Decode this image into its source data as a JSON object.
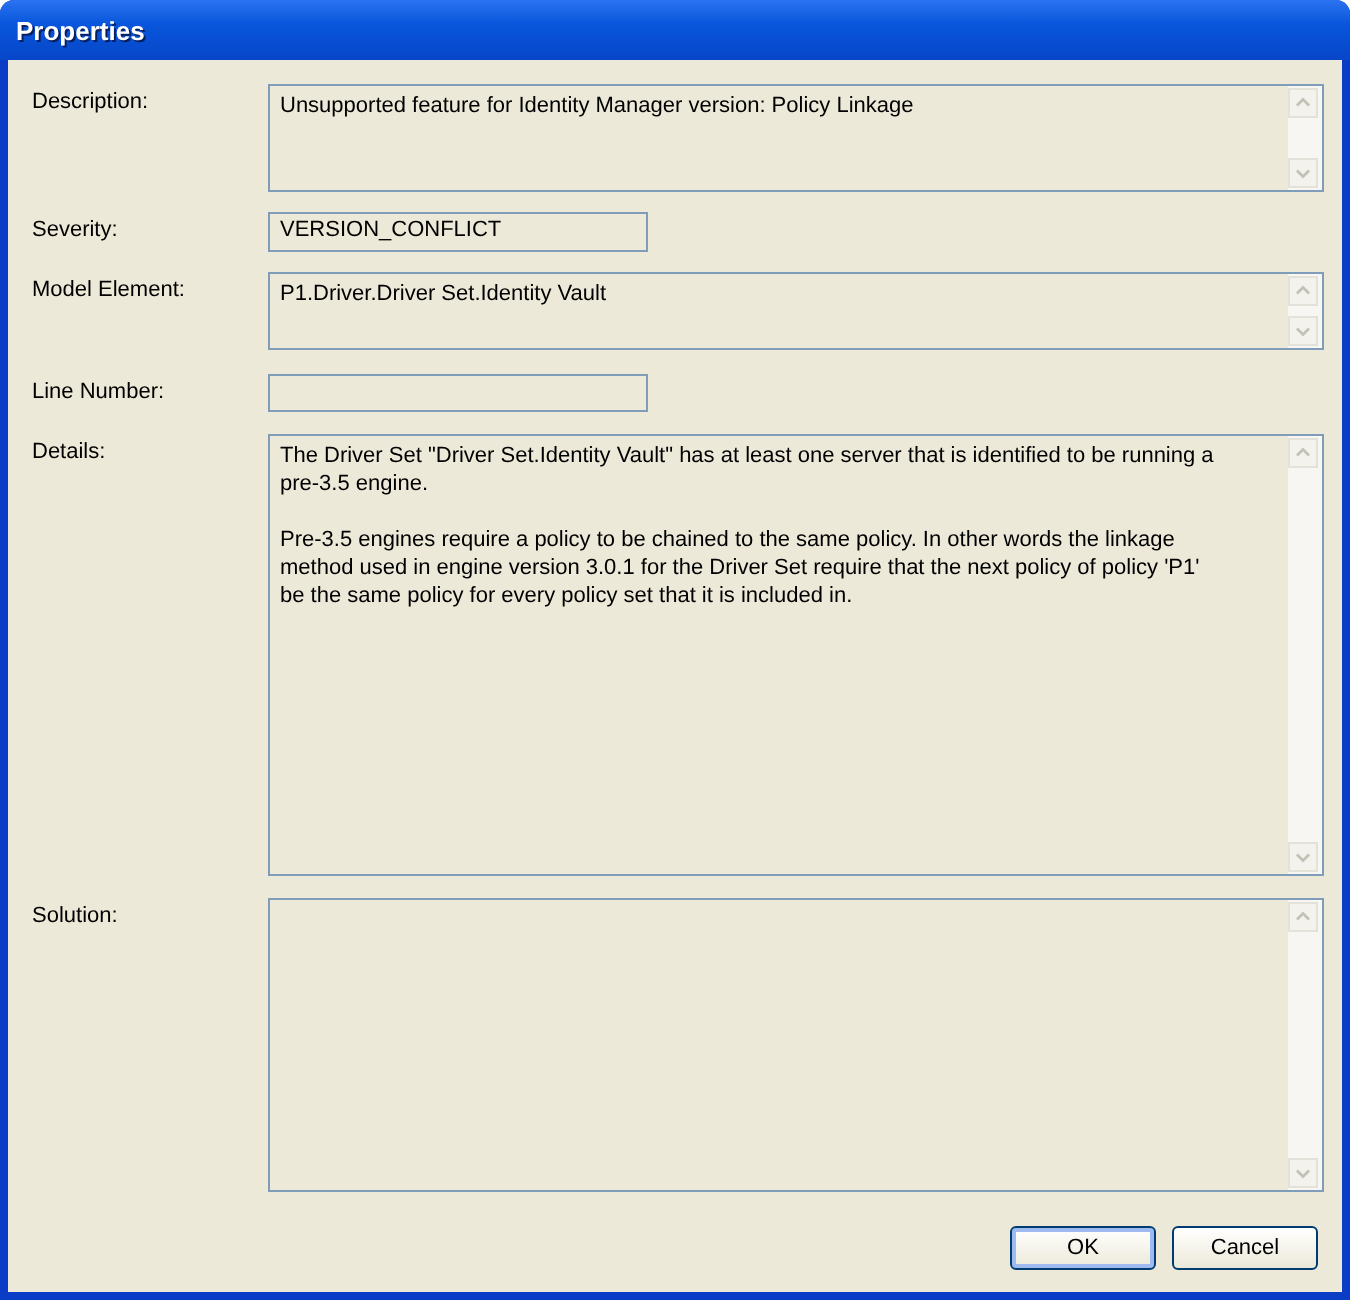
{
  "window": {
    "title": "Properties"
  },
  "fields": [
    {
      "label": "Description:",
      "kind": "textarea",
      "paragraphs": [
        "Unsupported feature for Identity Manager version: Policy Linkage"
      ]
    },
    {
      "label": "Severity:",
      "kind": "text",
      "value": "VERSION_CONFLICT"
    },
    {
      "label": "Model Element:",
      "kind": "textarea",
      "paragraphs": [
        "P1.Driver.Driver Set.Identity Vault"
      ]
    },
    {
      "label": "Line Number:",
      "kind": "text"
    },
    {
      "label": "Details:",
      "kind": "textarea",
      "paragraphs": [
        "The Driver Set \"Driver Set.Identity Vault\" has at least one server that is identified to be running a pre-3.5 engine.",
        "Pre-3.5 engines require a policy to be chained to the same policy. In other words the linkage method used in engine version 3.0.1 for the Driver Set require that the next policy of policy 'P1' be the same policy for every policy set that it is included in."
      ]
    },
    {
      "label": "Solution:",
      "kind": "textarea"
    }
  ],
  "buttons": [
    {
      "label": "OK",
      "default": true
    },
    {
      "label": "Cancel",
      "default": false
    }
  ]
}
